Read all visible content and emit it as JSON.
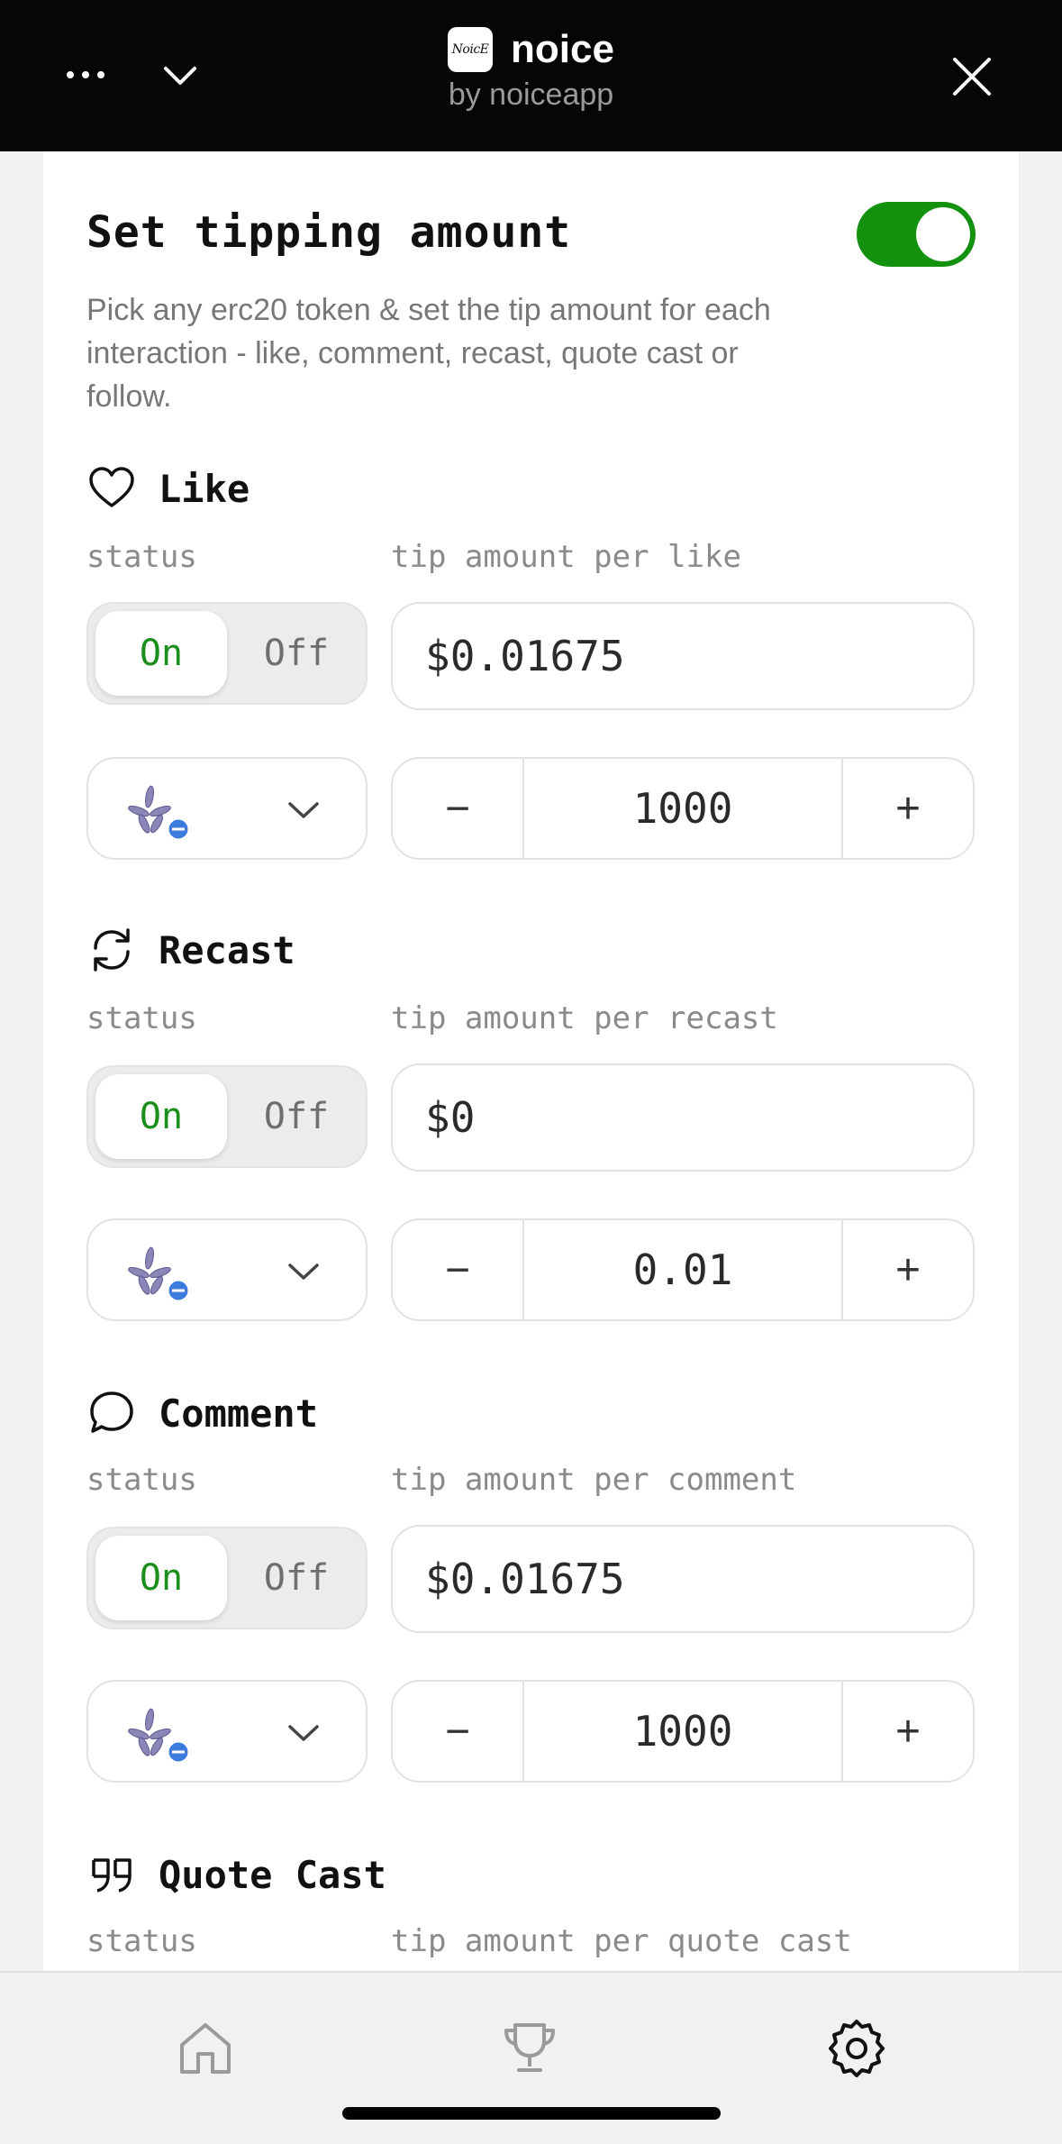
{
  "header": {
    "app_name": "noice",
    "app_by": "by noiceapp",
    "logo_text": "NoicE",
    "more_icon": "ellipsis-icon",
    "collapse_icon": "chevron-down-icon",
    "close_icon": "close-icon"
  },
  "settings": {
    "title": "Set tipping amount",
    "enabled": true,
    "description": "Pick any erc20 token & set the tip amount for each interaction - like, comment, recast, quote cast or follow."
  },
  "status_label": "status",
  "interactions": [
    {
      "key": "like",
      "icon": "heart-icon",
      "title": "Like",
      "amount_label": "tip amount per like",
      "status_on": "On",
      "status_off": "Off",
      "active": "On",
      "amount": "$0.01675",
      "quantity": "1000"
    },
    {
      "key": "recast",
      "icon": "recast-icon",
      "title": "Recast",
      "amount_label": "tip amount per recast",
      "status_on": "On",
      "status_off": "Off",
      "active": "On",
      "amount": "$0",
      "quantity": "0.01"
    },
    {
      "key": "comment",
      "icon": "comment-icon",
      "title": "Comment",
      "amount_label": "tip amount per comment",
      "status_on": "On",
      "status_off": "Off",
      "active": "On",
      "amount": "$0.01675",
      "quantity": "1000"
    },
    {
      "key": "quote",
      "icon": "quote-icon",
      "title": "Quote Cast",
      "amount_label": "tip amount per quote cast"
    }
  ],
  "stepper": {
    "minus": "−",
    "plus": "+"
  },
  "bottom_nav": [
    {
      "icon": "home-icon",
      "active": false
    },
    {
      "icon": "trophy-icon",
      "active": false
    },
    {
      "icon": "gear-icon",
      "active": true
    }
  ],
  "colors": {
    "accent_green": "#13910f",
    "on_text": "#1b8e1b",
    "header_bg": "#060606"
  }
}
